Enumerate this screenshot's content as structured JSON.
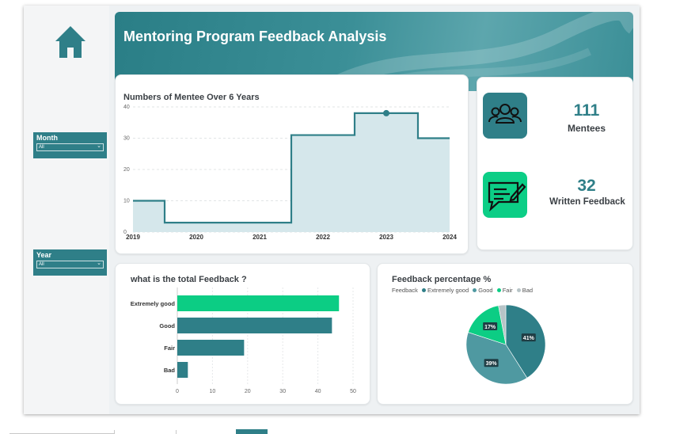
{
  "sidebar": {
    "home_icon": "home-icon",
    "slicers": [
      {
        "label": "Month",
        "value": "All"
      },
      {
        "label": "Year",
        "value": "All"
      }
    ]
  },
  "header": {
    "title": "Mentoring Program Feedback Analysis"
  },
  "kpis": [
    {
      "value": "111",
      "label": "Mentees",
      "icon": "people-group-icon",
      "color": "#2f7f88"
    },
    {
      "value": "32",
      "label": "Written Feedback",
      "icon": "feedback-message-icon",
      "color": "#0cce86"
    }
  ],
  "colors": {
    "teal": "#2f7f88",
    "green": "#0ccd84",
    "light_teal": "#4f99a1",
    "gray": "#b7c4c7"
  },
  "chart_data": [
    {
      "type": "line",
      "title": "Numbers of Mentee Over 6 Years",
      "x": [
        "2019",
        "2020",
        "2021",
        "2022",
        "2023",
        "2024"
      ],
      "values": [
        10,
        3,
        3,
        31,
        38,
        30
      ],
      "ylim": [
        0,
        40
      ],
      "yticks": [
        "0",
        "10",
        "20",
        "30",
        "40"
      ],
      "step": true,
      "area": true
    },
    {
      "type": "bar",
      "orientation": "horizontal",
      "title": "what is the total Feedback ?",
      "categories": [
        "Extremely good",
        "Good",
        "Fair",
        "Bad"
      ],
      "values": [
        46,
        44,
        19,
        3
      ],
      "xlim": [
        0,
        50
      ],
      "xticks": [
        "0",
        "10",
        "20",
        "30",
        "40",
        "50"
      ]
    },
    {
      "type": "pie",
      "title": "Feedback percentage %",
      "legend_title": "Feedback",
      "legend": [
        "Extremely good",
        "Good",
        "Fair",
        "Bad"
      ],
      "values": [
        41,
        39,
        17,
        3
      ],
      "labels": [
        "41%",
        "39%",
        "17%",
        ""
      ]
    }
  ]
}
